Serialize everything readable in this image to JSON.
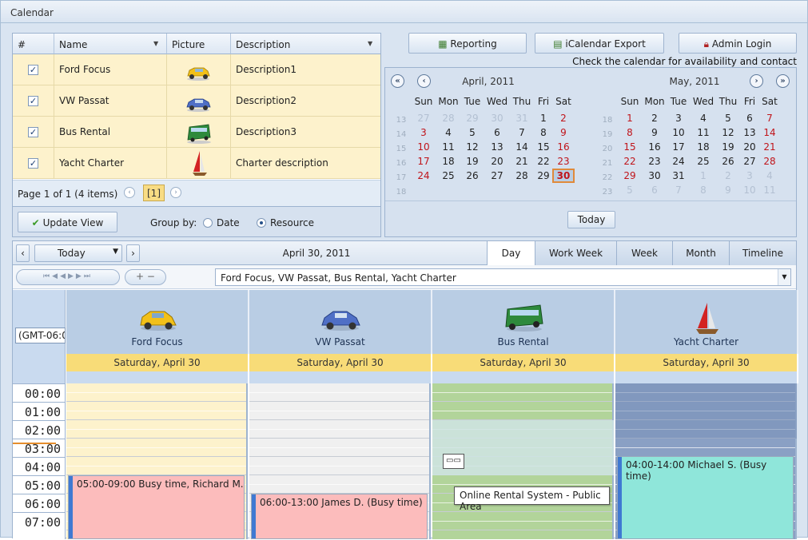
{
  "window": {
    "title": "Calendar"
  },
  "grid": {
    "headers": {
      "num": "#",
      "name": "Name",
      "picture": "Picture",
      "description": "Description"
    },
    "rows": [
      {
        "checked": true,
        "name": "Ford Focus",
        "picture": "car-yellow-icon",
        "description": "Description1"
      },
      {
        "checked": true,
        "name": "VW Passat",
        "picture": "car-blue-icon",
        "description": "Description2"
      },
      {
        "checked": true,
        "name": "Bus Rental",
        "picture": "bus-icon",
        "description": "Description3"
      },
      {
        "checked": true,
        "name": "Yacht Charter",
        "picture": "yacht-icon",
        "description": "Charter description"
      }
    ],
    "pager": {
      "text": "Page 1 of 1 (4 items)",
      "current": "[1]"
    },
    "update_button": "Update View",
    "group_by_label": "Group by:",
    "group_by_options": [
      "Date",
      "Resource"
    ],
    "group_by_selected": "Resource"
  },
  "top_buttons": {
    "reporting": "Reporting",
    "ical": "iCalendar Export",
    "admin": "Admin Login"
  },
  "availability_text": "Check the calendar for availability and contact us",
  "calendar": {
    "today_button": "Today",
    "dow": [
      "Sun",
      "Mon",
      "Tue",
      "Wed",
      "Thu",
      "Fri",
      "Sat"
    ],
    "months": [
      {
        "title": "April, 2011",
        "weeks": [
          "13",
          "14",
          "15",
          "16",
          "17",
          "18"
        ],
        "days": [
          [
            "27",
            "28",
            "29",
            "30",
            "31",
            "1",
            "2"
          ],
          [
            "3",
            "4",
            "5",
            "6",
            "7",
            "8",
            "9"
          ],
          [
            "10",
            "11",
            "12",
            "13",
            "14",
            "15",
            "16"
          ],
          [
            "17",
            "18",
            "19",
            "20",
            "21",
            "22",
            "23"
          ],
          [
            "24",
            "25",
            "26",
            "27",
            "28",
            "29",
            "30"
          ],
          [
            "",
            "",
            "",
            "",
            "",
            "",
            ""
          ]
        ]
      },
      {
        "title": "May, 2011",
        "weeks": [
          "18",
          "19",
          "20",
          "21",
          "22",
          "23"
        ],
        "days": [
          [
            "1",
            "2",
            "3",
            "4",
            "5",
            "6",
            "7"
          ],
          [
            "8",
            "9",
            "10",
            "11",
            "12",
            "13",
            "14"
          ],
          [
            "15",
            "16",
            "17",
            "18",
            "19",
            "20",
            "21"
          ],
          [
            "22",
            "23",
            "24",
            "25",
            "26",
            "27",
            "28"
          ],
          [
            "29",
            "30",
            "31",
            "1",
            "2",
            "3",
            "4"
          ],
          [
            "5",
            "6",
            "7",
            "8",
            "9",
            "10",
            "11"
          ]
        ]
      }
    ],
    "selected_day": "30"
  },
  "scheduler": {
    "today_button": "Today",
    "current_date": "April 30, 2011",
    "views": [
      "Day",
      "Work Week",
      "Week",
      "Month",
      "Timeline"
    ],
    "active_view": "Day",
    "resource_filter": "Ford Focus, VW Passat, Bus Rental, Yacht Charter",
    "timezone": "(GMT-06:0",
    "resources": [
      {
        "name": "Ford Focus",
        "icon": "car-yellow-icon",
        "date": "Saturday, April 30",
        "color": "#fdf2cc"
      },
      {
        "name": "VW Passat",
        "icon": "car-blue-icon",
        "date": "Saturday, April 30",
        "color": "#f0f0f0"
      },
      {
        "name": "Bus Rental",
        "icon": "bus-icon",
        "date": "Saturday, April 30",
        "color": "#b2d49a"
      },
      {
        "name": "Yacht Charter",
        "icon": "yacht-icon",
        "date": "Saturday, April 30",
        "color": "#8aa0c4"
      }
    ],
    "times": [
      "00:00",
      "01:00",
      "02:00",
      "03:00",
      "04:00",
      "05:00",
      "06:00",
      "07:00"
    ],
    "appointments": [
      {
        "text": "05:00-09:00 Busy time, Richard M.",
        "color": "#fcbcbc"
      },
      {
        "text": "06:00-13:00 James D. (Busy time)",
        "color": "#fcbcbc"
      },
      {
        "text": "04:00-14:00 Michael S. (Busy time)",
        "color": "#8fe6da"
      }
    ],
    "tooltip": "Online Rental System - Public Area"
  }
}
